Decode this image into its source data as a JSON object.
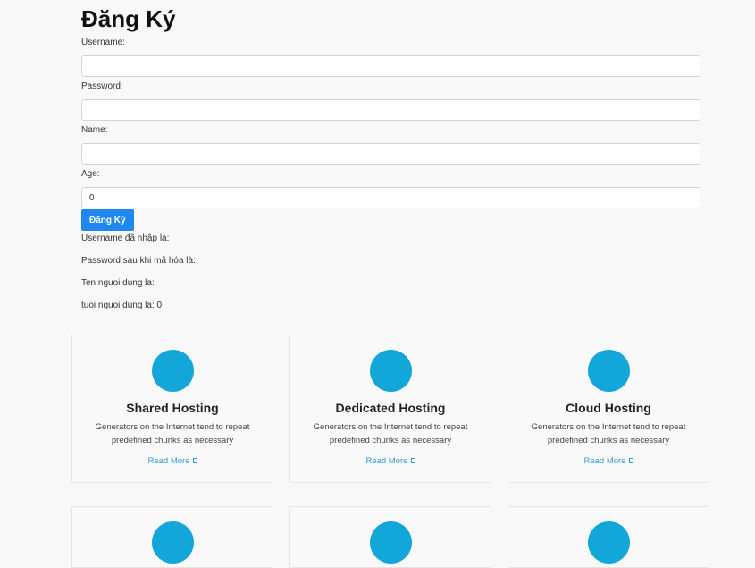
{
  "form": {
    "title": "Đăng Ký",
    "fields": [
      {
        "label": "Username:",
        "value": "",
        "placeholder": ""
      },
      {
        "label": "Password:",
        "value": "",
        "placeholder": ""
      },
      {
        "label": "Name:",
        "value": "",
        "placeholder": ""
      },
      {
        "label": "Age:",
        "value": "0",
        "placeholder": ""
      }
    ],
    "submit_label": "Đăng Ký"
  },
  "results": [
    "Username đã nhập là:",
    "Password sau khi mã hóa là:",
    "Ten nguoi dung la:",
    "tuoi nguoi dung la: 0"
  ],
  "cards": [
    {
      "title": "Shared Hosting",
      "desc_line1": "Generators on the Internet tend to repeat",
      "desc_line2": "predefined chunks as necessary",
      "link": "Read More",
      "icon": "circle-icon"
    },
    {
      "title": "Dedicated Hosting",
      "desc_line1": "Generators on the Internet tend to repeat",
      "desc_line2": "predefined chunks as necessary",
      "link": "Read More",
      "icon": "circle-icon"
    },
    {
      "title": "Cloud Hosting",
      "desc_line1": "Generators on the Internet tend to repeat",
      "desc_line2": "predefined chunks as necessary",
      "link": "Read More",
      "icon": "circle-icon"
    },
    {
      "icon": "circle-icon"
    },
    {
      "icon": "circle-icon"
    },
    {
      "icon": "circle-icon"
    }
  ],
  "colors": {
    "accent": "#1e88f0",
    "icon": "#12a7d8",
    "link": "#2f9bd6"
  }
}
